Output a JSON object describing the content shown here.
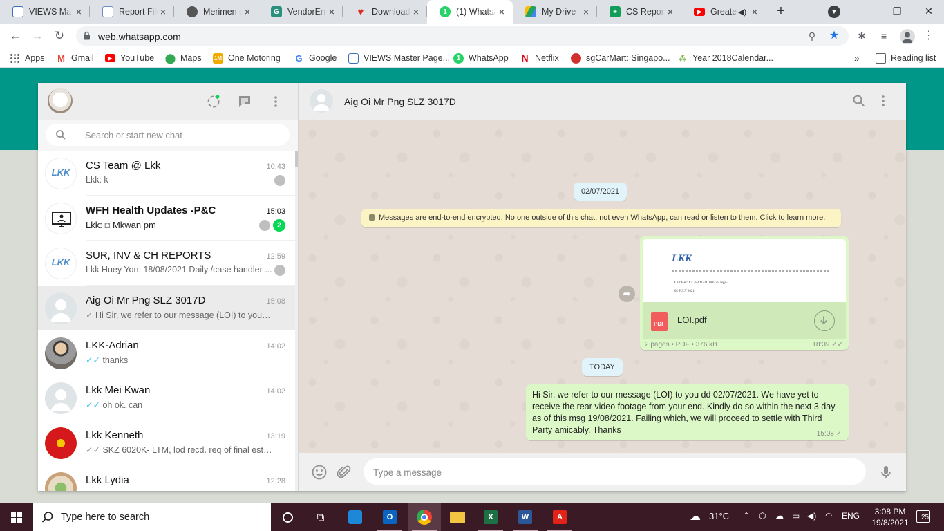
{
  "browser": {
    "tabs": [
      {
        "title": "VIEWS Ma",
        "icon": "doc-icon",
        "color": "#3b6fb6"
      },
      {
        "title": "Report File",
        "icon": "doc-icon",
        "color": "#6b8cc4"
      },
      {
        "title": "Merimen e",
        "icon": "merimen-icon",
        "color": "#555555"
      },
      {
        "title": "VendorEng",
        "icon": "vendor-icon",
        "color": "#2a8f7c"
      },
      {
        "title": "Download",
        "icon": "heart-icon",
        "color": "#d93025"
      },
      {
        "title": "(1) WhatsA",
        "icon": "whatsapp-icon",
        "color": "#25d366"
      },
      {
        "title": "My Drive -",
        "icon": "drive-icon",
        "color": "#1fa463"
      },
      {
        "title": "CS Report",
        "icon": "sheets-icon",
        "color": "#0f9d58"
      },
      {
        "title": "Greate",
        "icon": "youtube-icon",
        "color": "#ff0000"
      }
    ],
    "url": "web.whatsapp.com",
    "bookmarks": [
      {
        "label": "Apps",
        "icon": "apps-grid-icon",
        "color": "#5f6368"
      },
      {
        "label": "Gmail",
        "icon": "gmail-icon",
        "color": "#ea4335"
      },
      {
        "label": "YouTube",
        "icon": "youtube-icon",
        "color": "#ff0000"
      },
      {
        "label": "Maps",
        "icon": "maps-pin-icon",
        "color": "#34a853"
      },
      {
        "label": "One Motoring",
        "icon": "onemotoring-icon",
        "color": "#f2a900"
      },
      {
        "label": "Google",
        "icon": "google-icon",
        "color": "#4285f4"
      },
      {
        "label": "VIEWS Master Page...",
        "icon": "doc-icon",
        "color": "#3b6fb6"
      },
      {
        "label": "WhatsApp",
        "icon": "whatsapp-icon",
        "color": "#25d366"
      },
      {
        "label": "Netflix",
        "icon": "netflix-icon",
        "color": "#e50914"
      },
      {
        "label": "sgCarMart: Singapo...",
        "icon": "sgcarmart-icon",
        "color": "#d32f2f"
      },
      {
        "label": "Year 2018Calendar...",
        "icon": "calendar-icon",
        "color": "#7cb342"
      }
    ],
    "overflow": "»",
    "reading_list": "Reading list"
  },
  "sidebar": {
    "search_placeholder": "Search or start new chat",
    "chats": [
      {
        "name": "CS Team @ Lkk",
        "time": "10:43",
        "preview": "Lkk: k",
        "avatar": "lkk-logo",
        "pinned": true
      },
      {
        "name": "WFH Health Updates -P&C",
        "time": "15:03",
        "preview_sender": "Lkk:",
        "preview": "Mkwan pm",
        "avatar": "monitor",
        "pinned": true,
        "unread": "2"
      },
      {
        "name": "SUR, INV & CH REPORTS",
        "time": "12:59",
        "preview": "Lkk Huey Yon: 18/08/2021 Daily /case handler ...",
        "avatar": "lkk-logo",
        "pinned": true
      },
      {
        "name": "Aig Oi Mr Png SLZ 3017D",
        "time": "15:08",
        "preview": "Hi Sir, we refer to our message (LOI) to you dd...",
        "avatar": "default",
        "tick": "✓",
        "selected": true
      },
      {
        "name": "LKK-Adrian",
        "time": "14:02",
        "preview": "thanks",
        "avatar": "photo-child",
        "tick": "✓✓",
        "tick_color": "#4fc3f7"
      },
      {
        "name": "Lkk Mei Kwan",
        "time": "14:02",
        "preview": "oh ok. can",
        "avatar": "default",
        "tick": "✓✓",
        "tick_color": "#4fc3f7"
      },
      {
        "name": "Lkk Kenneth",
        "time": "13:19",
        "preview": "SKZ 6020K- LTM, lod recd. req of final est list. ...",
        "avatar": "manutd-crest",
        "tick": "✓✓",
        "tick_color": "#999999"
      },
      {
        "name": "Lkk Lydia",
        "time": "12:28",
        "preview": "",
        "avatar": "photo-food"
      }
    ]
  },
  "conversation": {
    "contact_name": "Aig Oi Mr Png SLZ 3017D",
    "date_chip_1": "02/07/2021",
    "encryption_notice": "Messages are end-to-end encrypted. No one outside of this chat, not even WhatsApp, can read or listen to them. Click to learn more.",
    "document": {
      "file_name": "LOI.pdf",
      "file_type_label": "PDF",
      "info": "2 pages • PDF • 376 kB",
      "time": "18:39",
      "preview_logo": "LKK",
      "preview_ref": "Our Ref: CC4-AIG21090535 Ngo3",
      "preview_date": "02 JULY 2021"
    },
    "date_chip_2": "TODAY",
    "text_message": "Hi Sir, we refer to our message (LOI) to you dd 02/07/2021. We have yet to receive the rear video footage from your end. Kindly do so within the next 3 day as of this msg 19/08/2021. Failing which, we will proceed to settle with Third Party amicably. Thanks",
    "text_time": "15:08",
    "compose_placeholder": "Type a message"
  },
  "taskbar": {
    "search_text": "Type here to search",
    "weather": "31°C",
    "language": "ENG",
    "time": "3:08 PM",
    "date": "19/8/2021",
    "notifications": "25"
  },
  "colors": {
    "teal": "#009688",
    "outgoing_bubble": "#dcf8c6",
    "unread_badge": "#06d755",
    "read_tick": "#4fc3f7"
  }
}
